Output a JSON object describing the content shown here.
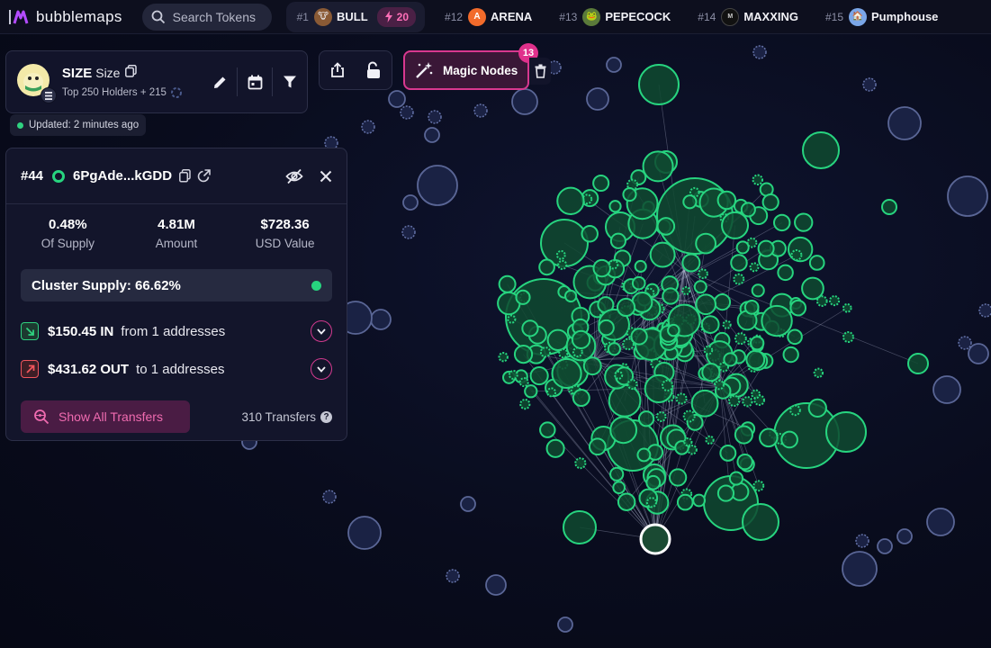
{
  "topbar": {
    "brand": "bubblemaps",
    "search_placeholder": "Search Tokens",
    "trending": [
      {
        "rank": "#1",
        "name": "BULL",
        "boost": "20",
        "icon": "bull-token-icon",
        "color": "#8a5a35"
      },
      {
        "rank": "#12",
        "name": "ARENA",
        "icon": "arena-token-icon",
        "color": "#f26b2b"
      },
      {
        "rank": "#13",
        "name": "PEPECOCK",
        "icon": "pepecock-token-icon",
        "color": "#5a7a3a"
      },
      {
        "rank": "#14",
        "name": "MAXXING",
        "icon": "maxxing-token-icon",
        "color": "#111111"
      },
      {
        "rank": "#15",
        "name": "Pumphouse",
        "icon": "pumphouse-token-icon",
        "color": "#7aa6e8"
      }
    ]
  },
  "token": {
    "symbol": "SIZE",
    "name": "Size",
    "holders_text": "Top 250 Holders + 215",
    "updated": "Updated: 2 minutes ago"
  },
  "magic_nodes": {
    "label": "Magic Nodes",
    "count": "13"
  },
  "wallet": {
    "rank": "#44",
    "address": "6PgAde...kGDD",
    "stats": [
      {
        "value": "0.48%",
        "label": "Of Supply"
      },
      {
        "value": "4.81M",
        "label": "Amount"
      },
      {
        "value": "$728.36",
        "label": "USD Value"
      }
    ],
    "cluster_supply": "Cluster Supply: 66.62%",
    "inflow": {
      "amount": "$150.45 IN",
      "desc": "from 1 addresses"
    },
    "outflow": {
      "amount": "$431.62 OUT",
      "desc": "to 1 addresses"
    },
    "show_all": "Show All Transfers",
    "transfers": "310 Transfers"
  },
  "colors": {
    "accent_pink": "#d8388f",
    "node_green": "#27d47f",
    "node_fill": "#0f4a30",
    "node_idle": "#1a2244"
  }
}
